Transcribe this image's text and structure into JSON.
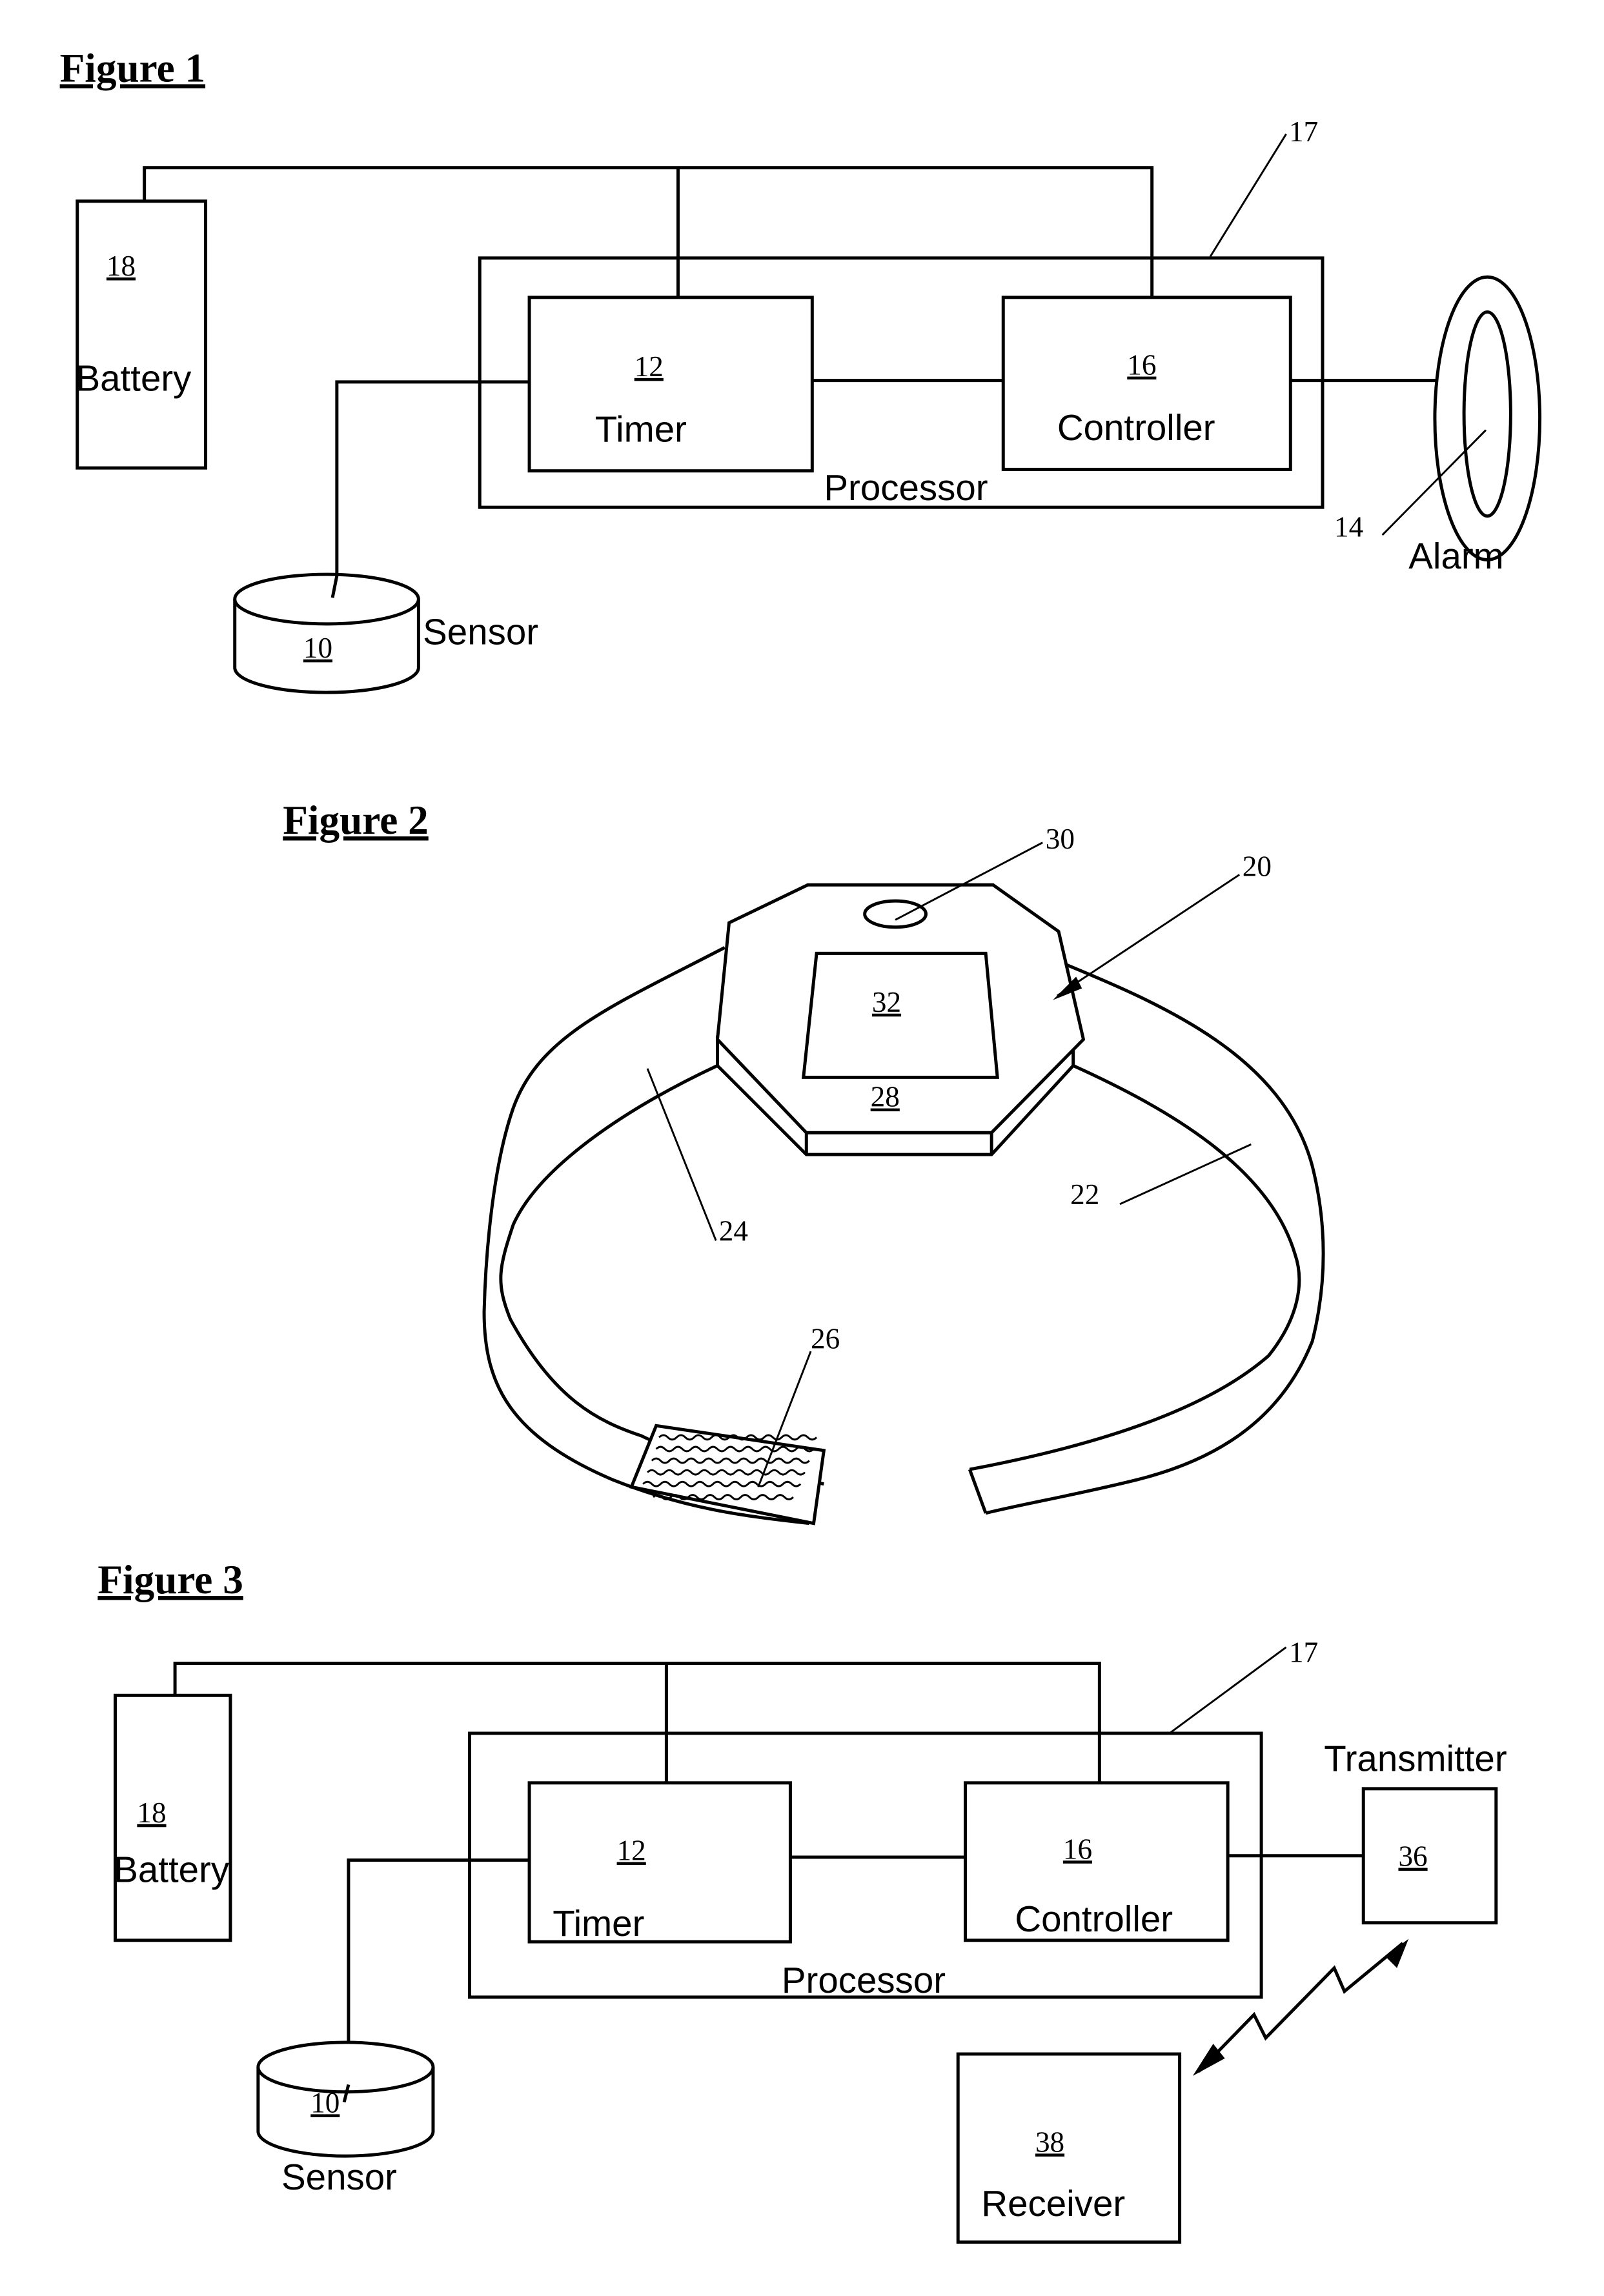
{
  "figures": {
    "fig1": {
      "title": "Figure 1",
      "battery": {
        "ref": "18",
        "label": "Battery"
      },
      "timer": {
        "ref": "12",
        "label": "Timer"
      },
      "controller": {
        "ref": "16",
        "label": "Controller"
      },
      "processor": {
        "ref": "17",
        "label": "Processor"
      },
      "alarm": {
        "ref": "14",
        "label": "Alarm"
      },
      "sensor": {
        "ref": "10",
        "label": "Sensor"
      }
    },
    "fig2": {
      "title": "Figure 2",
      "refs": {
        "device": "20",
        "band_right": "22",
        "band_left": "24",
        "fastener": "26",
        "housing": "28",
        "button": "30",
        "display": "32"
      }
    },
    "fig3": {
      "title": "Figure 3",
      "battery": {
        "ref": "18",
        "label": "Battery"
      },
      "timer": {
        "ref": "12",
        "label": "Timer"
      },
      "controller": {
        "ref": "16",
        "label": "Controller"
      },
      "processor": {
        "ref": "17",
        "label": "Processor"
      },
      "transmitter": {
        "ref": "36",
        "label": "Transmitter"
      },
      "receiver": {
        "ref": "38",
        "label": "Receiver"
      },
      "sensor": {
        "ref": "10",
        "label": "Sensor"
      }
    }
  }
}
